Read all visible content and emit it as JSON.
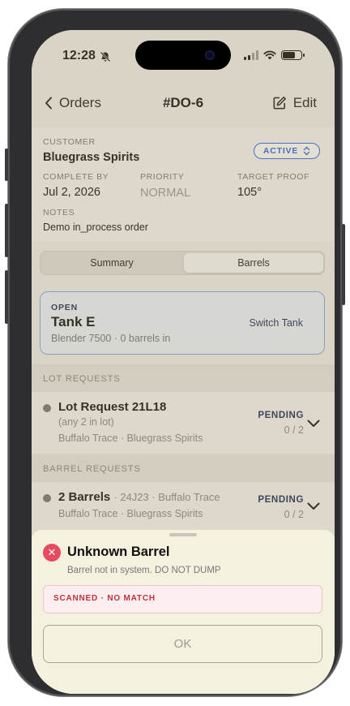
{
  "status_bar": {
    "time": "12:28"
  },
  "nav": {
    "back_label": "Orders",
    "title": "#DO-6",
    "edit_label": "Edit"
  },
  "order": {
    "customer_label": "CUSTOMER",
    "customer": "Bluegrass Spirits",
    "status": "ACTIVE",
    "complete_by_label": "COMPLETE BY",
    "complete_by": "Jul 2, 2026",
    "priority_label": "PRIORITY",
    "priority": "NORMAL",
    "target_proof_label": "TARGET PROOF",
    "target_proof": "105°",
    "notes_label": "NOTES",
    "notes": "Demo in_process order"
  },
  "tabs": [
    {
      "label": "Summary",
      "selected": false
    },
    {
      "label": "Barrels",
      "selected": true
    }
  ],
  "tank": {
    "state": "OPEN",
    "name": "Tank E",
    "detail": "Blender 7500 · 0 barrels in",
    "switch_label": "Switch Tank"
  },
  "lot_requests": {
    "header": "LOT REQUESTS",
    "items": [
      {
        "title": "Lot Request 21L18",
        "qualifier": "(any 2 in lot)",
        "detail": "Buffalo Trace · Bluegrass Spirits",
        "status": "PENDING",
        "count": "0 / 2"
      }
    ]
  },
  "barrel_requests": {
    "header": "BARREL REQUESTS",
    "items": [
      {
        "title": "2 Barrels",
        "inline_detail": "· 24J23 · Buffalo Trace",
        "detail": "Buffalo Trace · Bluegrass Spirits",
        "status": "PENDING",
        "count": "0 / 2"
      }
    ]
  },
  "sheet": {
    "icon": "error-x-icon",
    "title": "Unknown Barrel",
    "subtitle": "Barrel not in system. DO NOT DUMP",
    "match_text": "SCANNED · NO MATCH",
    "ok_label": "OK"
  },
  "colors": {
    "accent": "#2d6bd6",
    "error": "#e84a5f",
    "sheet_bg": "#f5f1df",
    "navy": "#1b2c55"
  }
}
